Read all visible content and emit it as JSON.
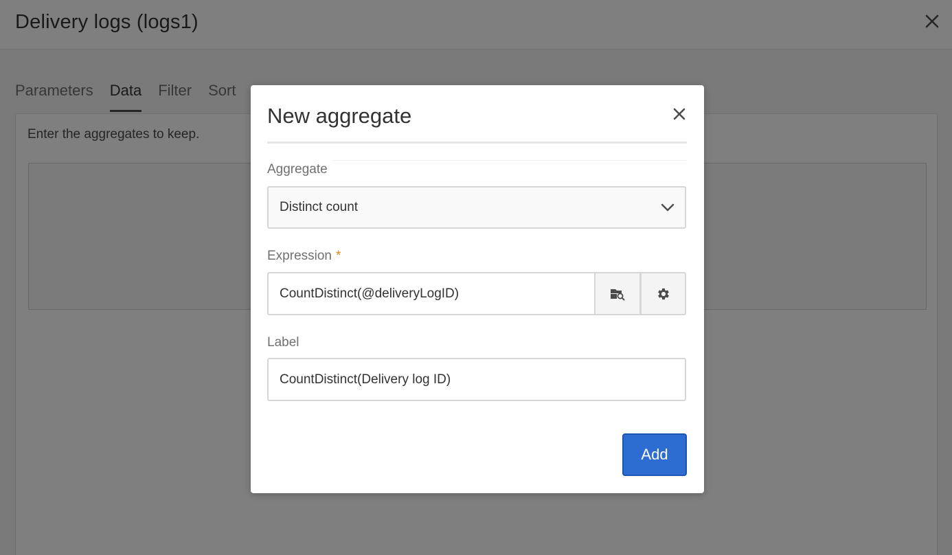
{
  "page": {
    "title": "Delivery logs (logs1)",
    "tabs": [
      {
        "label": "Parameters",
        "active": false
      },
      {
        "label": "Data",
        "active": true
      },
      {
        "label": "Filter",
        "active": false
      },
      {
        "label": "Sort",
        "active": false
      }
    ],
    "instruction": "Enter the aggregates to keep."
  },
  "modal": {
    "title": "New aggregate",
    "aggregate": {
      "label": "Aggregate",
      "value": "Distinct count"
    },
    "expression": {
      "label": "Expression",
      "required_mark": "*",
      "value": "CountDistinct(@deliveryLogID)"
    },
    "label_field": {
      "label": "Label",
      "value": "CountDistinct(Delivery log ID)"
    },
    "add_label": "Add"
  },
  "colors": {
    "accent": "#2d6cd1",
    "required": "#e68619",
    "overlay": "rgba(0,0,0,0.5)"
  },
  "icons": {
    "page_close": "close-icon",
    "modal_close": "close-icon",
    "select": "chevron-down-icon",
    "browse": "folder-search-icon",
    "settings": "gear-icon"
  }
}
